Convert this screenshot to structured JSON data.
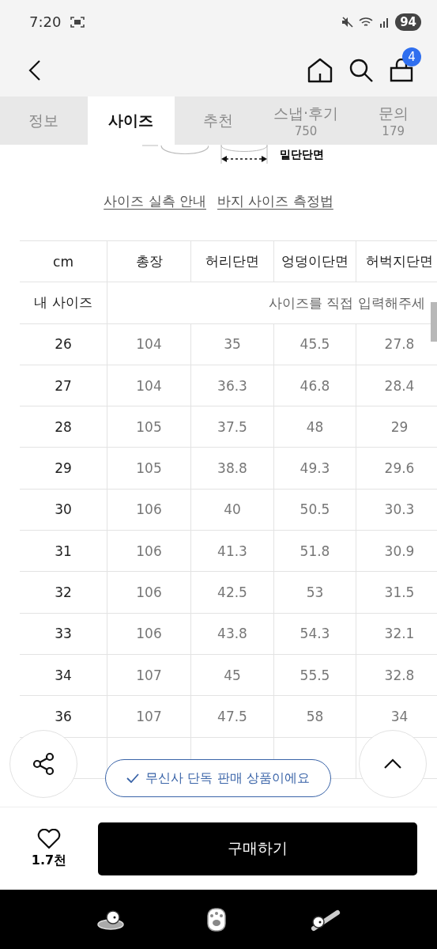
{
  "status_bar": {
    "time": "7:20",
    "battery": "94"
  },
  "header": {
    "cart_count": "4"
  },
  "tabs": [
    {
      "label": "정보",
      "selected": false
    },
    {
      "label": "사이즈",
      "selected": true
    },
    {
      "label": "추천",
      "selected": false
    },
    {
      "label": "스냅·후기",
      "count": "750",
      "selected": false
    },
    {
      "label": "문의",
      "count": "179",
      "selected": false
    }
  ],
  "diagram": {
    "label": "밑단단면"
  },
  "links": [
    "사이즈 실측 안내",
    "바지 사이즈 측정법"
  ],
  "size_table": {
    "columns": [
      "cm",
      "총장",
      "허리단면",
      "엉덩이단면",
      "허벅지단면"
    ],
    "my_size": {
      "label": "내 사이즈",
      "placeholder": "사이즈를 직접 입력해주세"
    },
    "rows": [
      [
        "26",
        "104",
        "35",
        "45.5",
        "27.8"
      ],
      [
        "27",
        "104",
        "36.3",
        "46.8",
        "28.4"
      ],
      [
        "28",
        "105",
        "37.5",
        "48",
        "29"
      ],
      [
        "29",
        "105",
        "38.8",
        "49.3",
        "29.6"
      ],
      [
        "30",
        "106",
        "40",
        "50.5",
        "30.3"
      ],
      [
        "31",
        "106",
        "41.3",
        "51.8",
        "30.9"
      ],
      [
        "32",
        "106",
        "42.5",
        "53",
        "31.5"
      ],
      [
        "33",
        "106",
        "43.8",
        "54.3",
        "32.1"
      ],
      [
        "34",
        "107",
        "45",
        "55.5",
        "32.8"
      ],
      [
        "36",
        "107",
        "47.5",
        "58",
        "34"
      ]
    ]
  },
  "toast": "무신사 단독 판매 상품이에요",
  "bottom_bar": {
    "likes": "1.7천",
    "liked": false,
    "buy_button": "구매하기"
  }
}
